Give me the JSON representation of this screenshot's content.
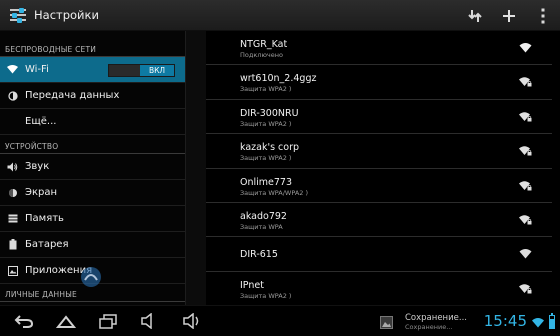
{
  "actionbar": {
    "title": "Настройки",
    "icons": [
      "settings-app-icon",
      "scan-icon",
      "add-network-icon",
      "overflow-menu-icon"
    ]
  },
  "sidebar": {
    "sections": [
      {
        "header": "БЕСПРОВОДНЫЕ СЕТИ",
        "items": [
          {
            "label": "Wi-Fi",
            "icon": "wifi-icon",
            "selected": true,
            "toggle": "ВКЛ"
          },
          {
            "label": "Передача данных",
            "icon": "data-usage-icon"
          },
          {
            "label": "Ещё...",
            "icon": ""
          }
        ]
      },
      {
        "header": "УСТРОЙСТВО",
        "items": [
          {
            "label": "Звук",
            "icon": "sound-icon"
          },
          {
            "label": "Экран",
            "icon": "display-icon"
          },
          {
            "label": "Память",
            "icon": "storage-icon"
          },
          {
            "label": "Батарея",
            "icon": "battery-icon"
          },
          {
            "label": "Приложения",
            "icon": "apps-icon"
          }
        ]
      },
      {
        "header": "ЛИЧНЫЕ ДАННЫЕ",
        "items": []
      }
    ]
  },
  "networks": [
    {
      "name": "NTGR_Kat",
      "status": "Подключено"
    },
    {
      "name": "wrt610n_2.4ggz",
      "status": "Защита WPA2 )"
    },
    {
      "name": "DIR-300NRU",
      "status": "Защита WPA2 )"
    },
    {
      "name": "kazak's corp",
      "status": "Защита WPA2 )"
    },
    {
      "name": "Onlime773",
      "status": "Защита WPA/WPA2 )"
    },
    {
      "name": "akado792",
      "status": "Защита WPA"
    },
    {
      "name": "DIR-615",
      "status": ""
    },
    {
      "name": "IPnet",
      "status": "Защита WPA2 )"
    }
  ],
  "systembar": {
    "nav": [
      "back-icon",
      "home-icon",
      "recent-apps-icon",
      "volume-down-icon",
      "volume-up-icon"
    ],
    "notification_title": "Сохранение...",
    "notification_sub": "Сохранение...",
    "clock": "15:45",
    "battery_level": 0.75
  },
  "colors": {
    "accent": "#33b5e5",
    "selected_bg": "#0d6b8c",
    "toggle_on": "#0e7aa3"
  }
}
